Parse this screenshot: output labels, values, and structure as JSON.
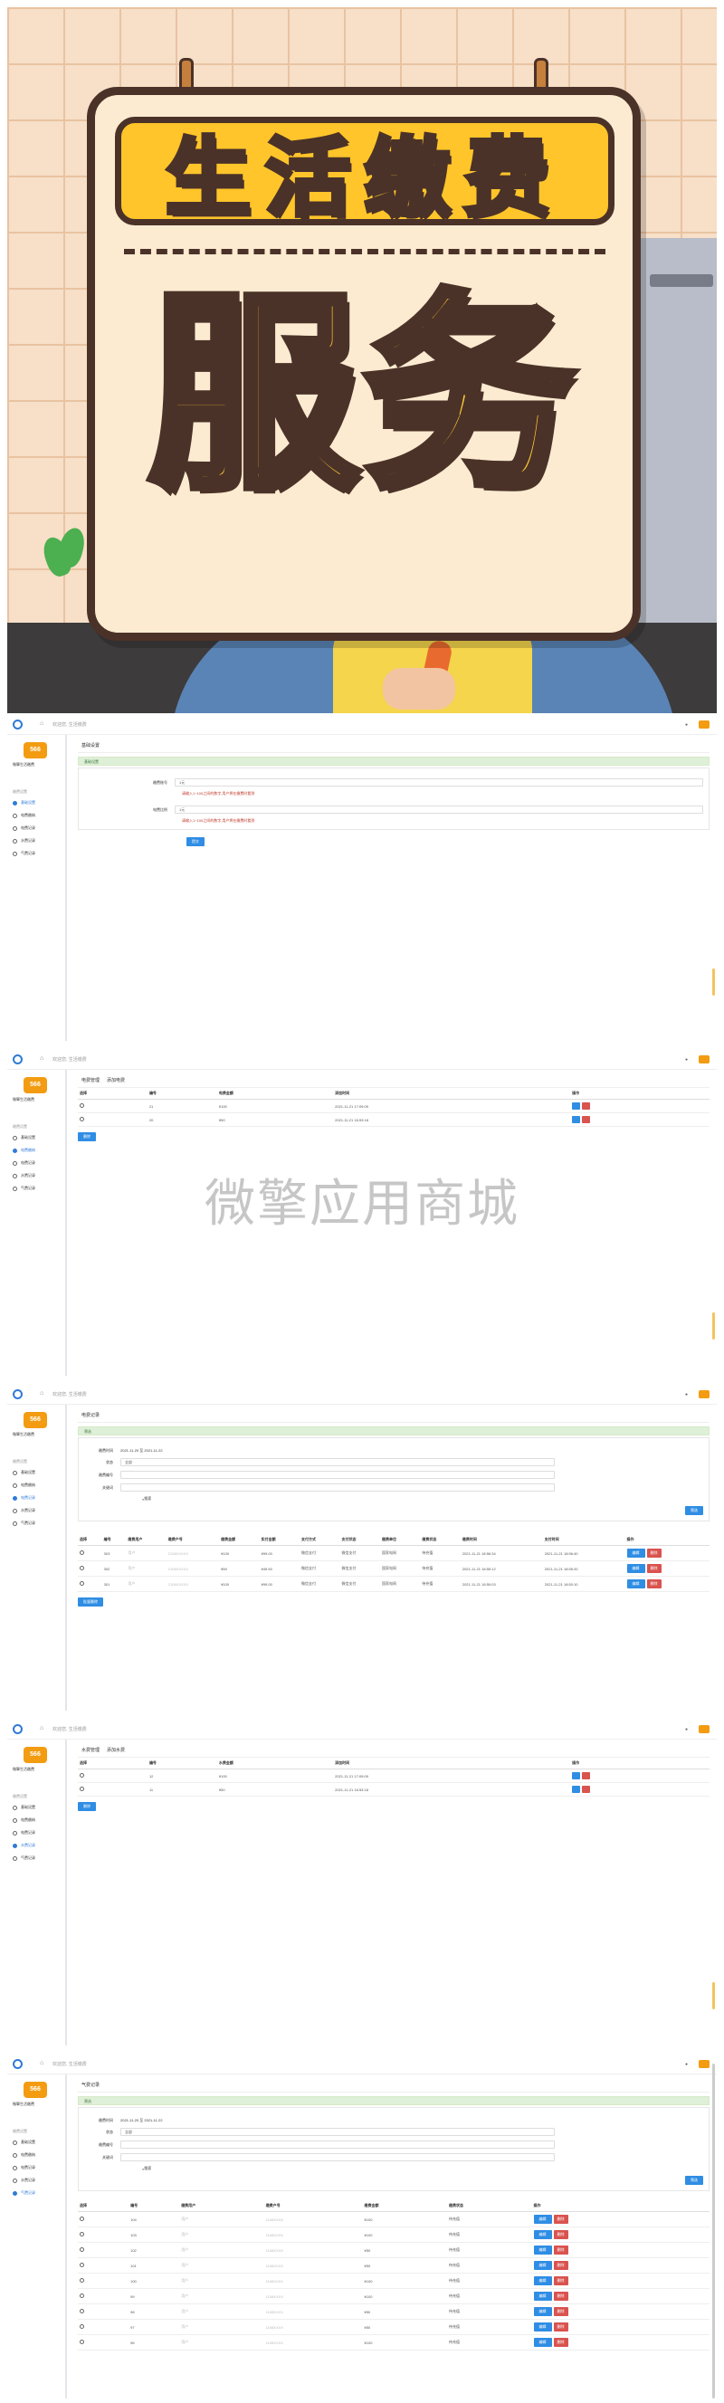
{
  "poster": {
    "banner_text": "生活缴费",
    "big_text": "服务"
  },
  "topbar": {
    "crumb": "欢迎您, 生活缴费"
  },
  "sidebar": {
    "brand": "566",
    "name": "微擎生活缴费",
    "section": "缴费设置",
    "items": [
      {
        "label": "基础设置"
      },
      {
        "label": "电费缴纳"
      },
      {
        "label": "电费记录"
      },
      {
        "label": "水费记录"
      },
      {
        "label": "气费记录"
      }
    ]
  },
  "settings_panel": {
    "tab": "基础设置",
    "bar": "基础设置",
    "fields": [
      {
        "label": "缴费账号",
        "value": "1元",
        "hint": "请输入1~100之间的数字,用户将在缴费时看到"
      },
      {
        "label": "电费比例",
        "value": "1元",
        "hint": "请输入1~100之间的数字,用户将在缴费时看到"
      }
    ],
    "submit": "提交"
  },
  "list_panel": {
    "tabs": [
      "电费管理",
      "添加电费"
    ],
    "columns": [
      "选择",
      "编号",
      "电费金额",
      "添加时间",
      "操作"
    ],
    "rows": [
      {
        "id": "21",
        "amount": "¥100",
        "time": "2021-11-21 17:09:09"
      },
      {
        "id": "20",
        "amount": "¥50",
        "time": "2021-11-21 16:53:18"
      }
    ],
    "delete_label": "删除"
  },
  "watermark": "微擎应用商城",
  "record_panel": {
    "tab": "电费记录",
    "bar": "筛选",
    "filter_rows": [
      {
        "label": "缴费时间",
        "value": "2021-11-20 至 2021-11-22"
      },
      {
        "label": "状态",
        "value": "全部"
      },
      {
        "label": "缴费编号",
        "value": ""
      },
      {
        "label": "关键词",
        "value": ""
      }
    ],
    "search_label": "搜索",
    "filter_button": "筛选",
    "columns": [
      "选择",
      "编号",
      "缴费用户",
      "缴费户号",
      "缴费金额",
      "实付金额",
      "支付方式",
      "支付状态",
      "缴费单位",
      "缴费状态",
      "缴费时间",
      "支付时间",
      "操作"
    ],
    "rows": [
      {
        "id": "303",
        "user": "用户",
        "account": "2108XXXXX",
        "amount": "¥100",
        "paid": "¥99.00",
        "pay_type": "微信支付",
        "pay_state": "微信支付",
        "unit": "国家电网",
        "state": "待充值",
        "time": "2021-11-21 18:56:34",
        "pay_time": "2021-11-21 18:56:40"
      },
      {
        "id": "302",
        "user": "用户",
        "account": "2108XXXXX",
        "amount": "¥50",
        "paid": "¥49.50",
        "pay_type": "微信支付",
        "pay_state": "微信支付",
        "unit": "国家电网",
        "state": "待充值",
        "time": "2021-11-21 18:55:12",
        "pay_time": "2021-11-21 18:55:20"
      },
      {
        "id": "301",
        "user": "用户",
        "account": "2108XXXXX",
        "amount": "¥100",
        "paid": "¥99.00",
        "pay_type": "微信支付",
        "pay_state": "微信支付",
        "unit": "国家电网",
        "state": "待充值",
        "time": "2021-11-21 18:50:03",
        "pay_time": "2021-11-21 18:50:10"
      }
    ],
    "batch_button": "批量删除",
    "edit_label": "编辑",
    "delete_label": "删除"
  },
  "water_list": {
    "tabs": [
      "水费管理",
      "添加水费"
    ],
    "columns": [
      "选择",
      "编号",
      "水费金额",
      "添加时间",
      "操作"
    ],
    "rows": [
      {
        "id": "12",
        "amount": "¥100",
        "time": "2021-11-21 17:09:09"
      },
      {
        "id": "11",
        "amount": "¥50",
        "time": "2021-11-21 16:53:18"
      }
    ]
  },
  "gas_record": {
    "tab": "气费记录",
    "bar": "筛选",
    "rows": [
      {
        "id": "104",
        "user": "用户",
        "account": "1108XXXX",
        "amount": "¥100",
        "state": "待充值"
      },
      {
        "id": "103",
        "user": "用户",
        "account": "1108XXXX",
        "amount": "¥100",
        "state": "待充值"
      },
      {
        "id": "102",
        "user": "用户",
        "account": "1108XXXX",
        "amount": "¥50",
        "state": "待充值"
      },
      {
        "id": "101",
        "user": "用户",
        "account": "1108XXXX",
        "amount": "¥50",
        "state": "待充值"
      },
      {
        "id": "100",
        "user": "用户",
        "account": "1108XXXX",
        "amount": "¥100",
        "state": "待充值"
      },
      {
        "id": "99",
        "user": "用户",
        "account": "1108XXXX",
        "amount": "¥100",
        "state": "待充值"
      },
      {
        "id": "98",
        "user": "用户",
        "account": "1108XXXX",
        "amount": "¥50",
        "state": "待充值"
      },
      {
        "id": "97",
        "user": "用户",
        "account": "1108XXXX",
        "amount": "¥50",
        "state": "待充值"
      },
      {
        "id": "96",
        "user": "用户",
        "account": "1108XXXX",
        "amount": "¥100",
        "state": "待充值"
      }
    ]
  }
}
